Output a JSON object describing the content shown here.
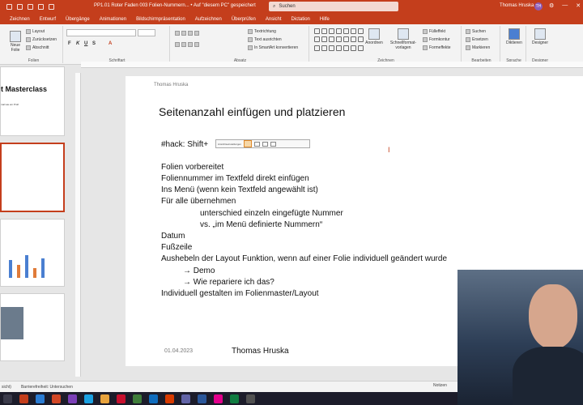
{
  "titlebar": {
    "doc_title": "PP1.01 Roter Faden 003 Folien-Nummern... • Auf \"diesem PC\" gespeichert",
    "search_placeholder": "Suchen",
    "user_name": "Thomas Hruska",
    "user_initials": "TH"
  },
  "tabs": [
    "Zeichnen",
    "Entwurf",
    "Übergänge",
    "Animationen",
    "Bildschirmpräsentation",
    "Aufzeichnen",
    "Überprüfen",
    "Ansicht",
    "Dictation",
    "Hilfe"
  ],
  "ribbon": {
    "new_slide": "Neue Folie",
    "layout": "Layout",
    "reset": "Zurücksetzen",
    "section": "Abschnitt",
    "group_slides": "Folien",
    "group_font": "Schriftart",
    "group_paragraph": "Absatz",
    "text_direction": "Textrichtung",
    "align_text": "Text ausrichten",
    "convert_smartart": "In SmartArt konvertieren",
    "arrange": "Anordnen",
    "quick_styles": "Schnellformat-vorlagen",
    "fill": "Fülleffekt",
    "outline": "Formkontur",
    "effects": "Formeffekte",
    "group_drawing": "Zeichnen",
    "find": "Suchen",
    "replace": "Ersetzen",
    "select": "Markieren",
    "group_editing": "Bearbeiten",
    "dictate": "Diktieren",
    "group_voice": "Sprache",
    "designer": "Designer",
    "group_designer": "Designer"
  },
  "thumbnails": {
    "first_title": "t Masterclass",
    "first_sub": "mal wie ein Profi"
  },
  "slide": {
    "author": "Thomas Hruska",
    "title": "Seitenanzahl einfügen und platzieren",
    "hack": "#hack: Shift+",
    "toolbar_label": "Ansichtseinstellungen",
    "lines": [
      "Folien vorbereitet",
      "Foliennummer im Textfeld direkt einfügen",
      "Ins Menü (wenn kein Textfeld angewählt ist)",
      "Für alle übernehmen",
      "unterschied  einzeln eingefügte Nummer",
      "vs. „im Menü definierte Nummern“",
      "Datum",
      "Fußzeile",
      "Aushebeln der Layout Funktion, wenn auf einer Folie individuell geändert wurde",
      "→ Demo",
      "→ Wie repariere ich das?",
      "Individuell gestalten im Folienmaster/Layout"
    ],
    "date": "01.04.2023",
    "footer": "Thomas Hruska"
  },
  "statusbar": {
    "slide_info": "sicht)",
    "accessibility": "Barrierefreiheit: Untersuchen",
    "notes": "Notizen"
  },
  "colors": {
    "accent": "#c43e1c",
    "ribbon_bg": "#f3f3f3",
    "workspace": "#e6e6e6"
  }
}
